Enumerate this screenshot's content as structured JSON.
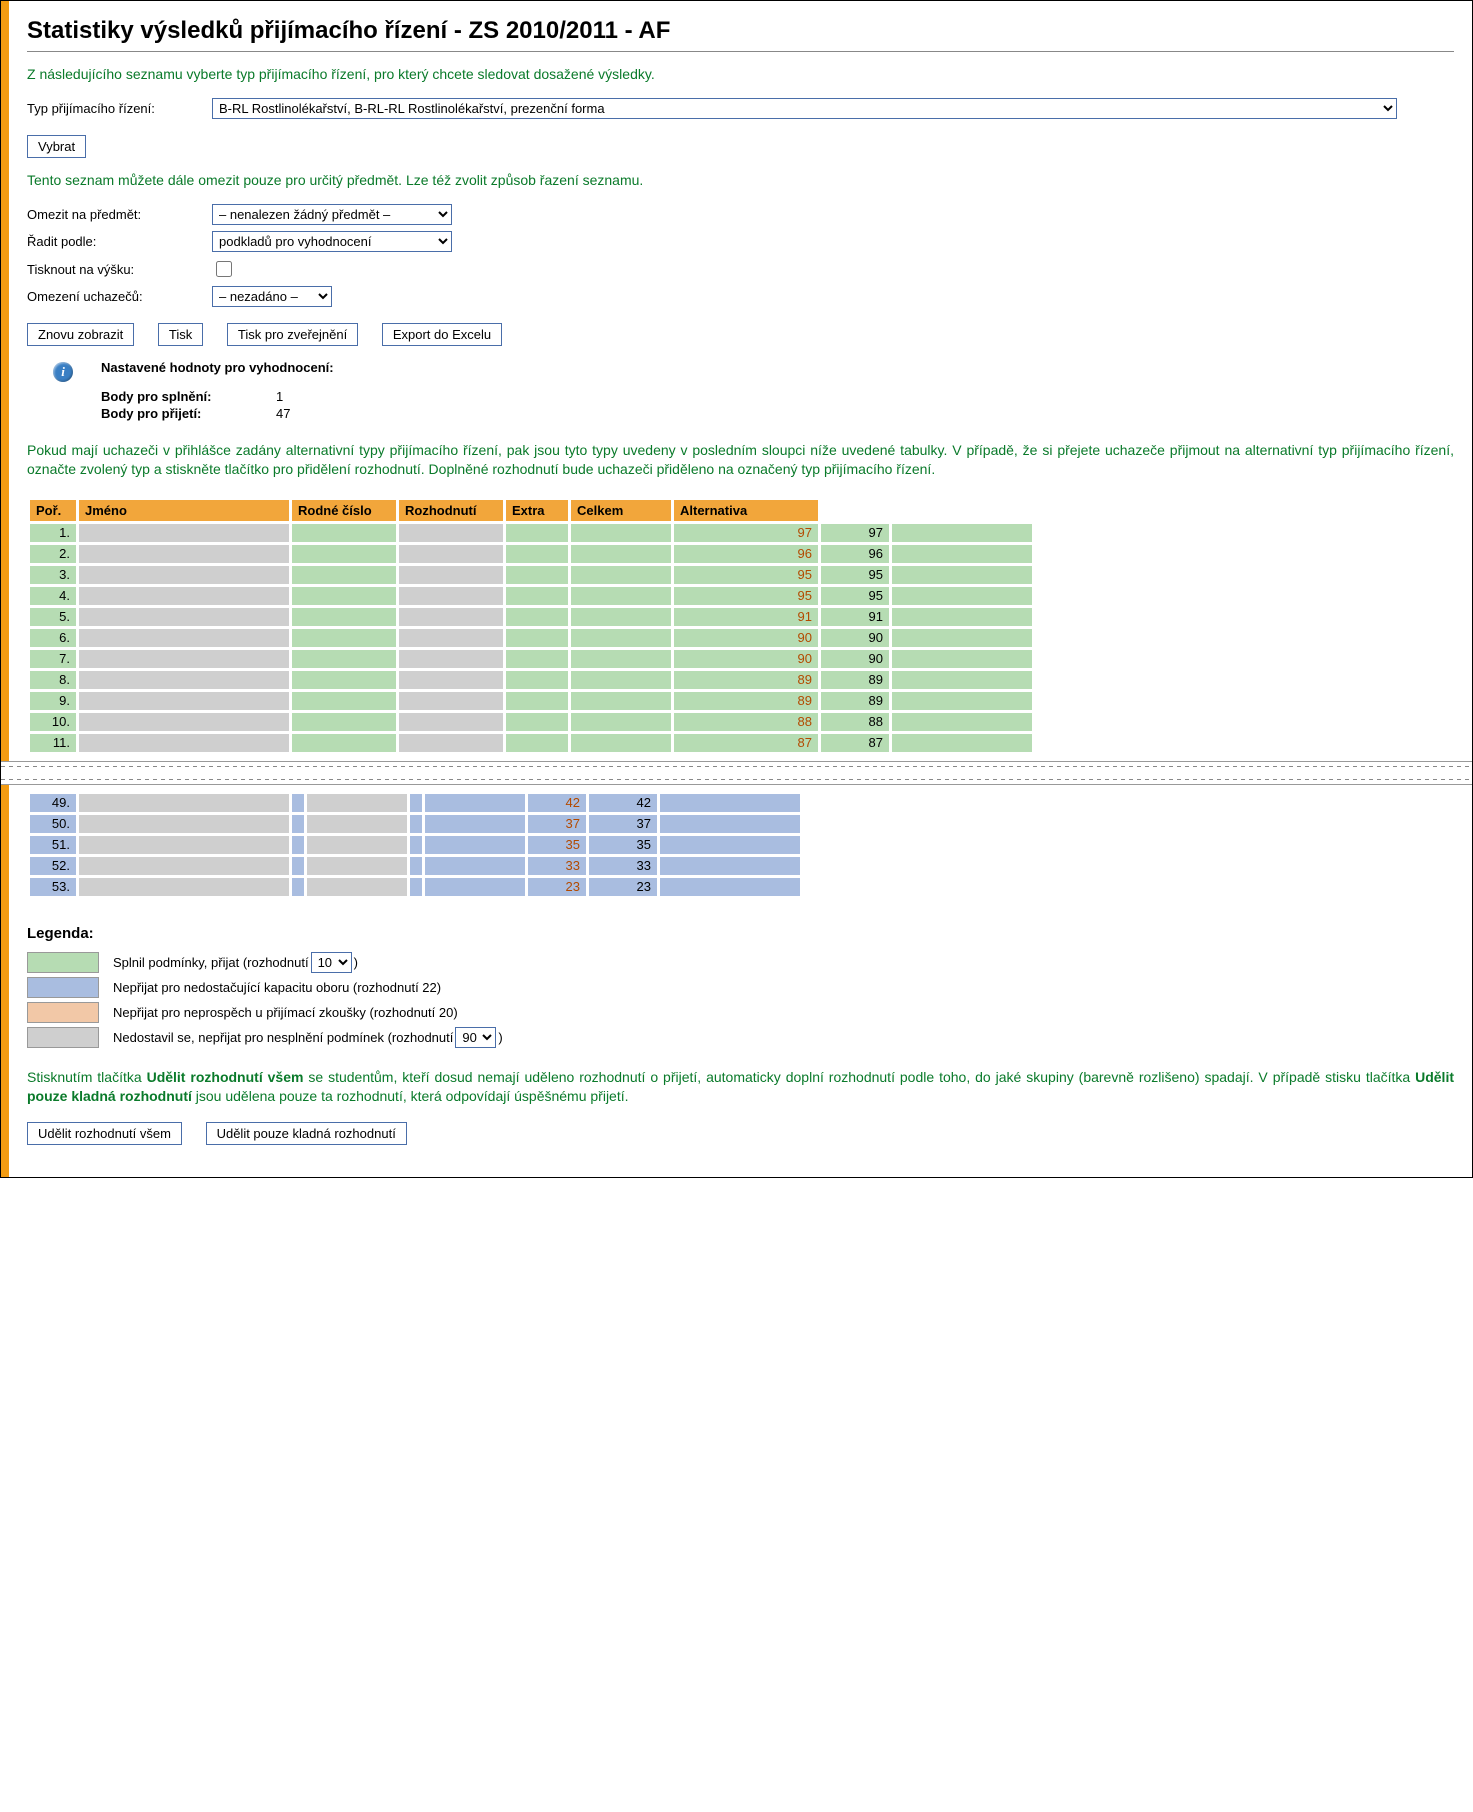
{
  "title": "Statistiky výsledků přijímacího řízení - ZS 2010/2011 - AF",
  "intro": "Z následujícího seznamu vyberte typ přijímacího řízení, pro který chcete sledovat dosažené výsledky.",
  "form": {
    "type_label": "Typ přijímacího řízení:",
    "type_value": "B-RL Rostlinolékařství, B-RL-RL Rostlinolékařství, prezenční forma",
    "select_btn": "Vybrat",
    "filter_intro": "Tento seznam můžete dále omezit pouze pro určitý předmět. Lze též zvolit způsob řazení seznamu.",
    "subject_label": "Omezit na předmět:",
    "subject_value": "– nenalezen žádný předmět –",
    "sort_label": "Řadit podle:",
    "sort_value": "podkladů pro vyhodnocení",
    "print_height_label": "Tisknout na výšku:",
    "limit_label": "Omezení uchazečů:",
    "limit_value": "– nezadáno –",
    "buttons": {
      "refresh": "Znovu zobrazit",
      "print": "Tisk",
      "print_publish": "Tisk pro zveřejnění",
      "export": "Export do Excelu"
    }
  },
  "settings": {
    "heading": "Nastavené hodnoty pro vyhodnocení:",
    "pass_label": "Body pro splnění:",
    "pass_value": "1",
    "admit_label": "Body pro přijetí:",
    "admit_value": "47"
  },
  "paragraph": "Pokud mají uchazeči v přihlášce zadány alternativní typy přijímacího řízení, pak jsou tyto typy uvedeny v posledním sloupci níže uvedené tabulky. V případě, že si přejete uchazeče přijmout na alternativní typ přijímacího řízení, označte zvolený typ a stiskněte tlačítko pro přidělení rozhodnutí. Doplněné rozhodnutí bude uchazeči přiděleno na označený typ přijímacího řízení.",
  "table": {
    "headers": {
      "por": "Poř.",
      "jmeno": "Jméno",
      "rc": "Rodné číslo",
      "roz": "Rozhodnutí",
      "extra": "Extra",
      "celkem": "Celkem",
      "alt": "Alternativa"
    },
    "rows_top": [
      {
        "por": "1.",
        "extra": "97",
        "celkem": "97"
      },
      {
        "por": "2.",
        "extra": "96",
        "celkem": "96"
      },
      {
        "por": "3.",
        "extra": "95",
        "celkem": "95"
      },
      {
        "por": "4.",
        "extra": "95",
        "celkem": "95"
      },
      {
        "por": "5.",
        "extra": "91",
        "celkem": "91"
      },
      {
        "por": "6.",
        "extra": "90",
        "celkem": "90"
      },
      {
        "por": "7.",
        "extra": "90",
        "celkem": "90"
      },
      {
        "por": "8.",
        "extra": "89",
        "celkem": "89"
      },
      {
        "por": "9.",
        "extra": "89",
        "celkem": "89"
      },
      {
        "por": "10.",
        "extra": "88",
        "celkem": "88"
      },
      {
        "por": "11.",
        "extra": "87",
        "celkem": "87"
      }
    ],
    "rows_bottom": [
      {
        "por": "49.",
        "extra": "42",
        "celkem": "42"
      },
      {
        "por": "50.",
        "extra": "37",
        "celkem": "37"
      },
      {
        "por": "51.",
        "extra": "35",
        "celkem": "35"
      },
      {
        "por": "52.",
        "extra": "33",
        "celkem": "33"
      },
      {
        "por": "53.",
        "extra": "23",
        "celkem": "23"
      }
    ]
  },
  "legend": {
    "heading": "Legenda:",
    "green_pre": "Splnil podmínky, přijat (rozhodnutí ",
    "green_sel": "10",
    "green_post": ")",
    "blue": "Nepřijat pro nedostačující kapacitu oboru (rozhodnutí 22)",
    "orange": "Nepřijat pro neprospěch u přijímací zkoušky (rozhodnutí 20)",
    "grey_pre": "Nedostavil se, nepřijat pro nesplnění podmínek (rozhodnutí ",
    "grey_sel": "90",
    "grey_post": ")"
  },
  "final": {
    "pre": "Stisknutím tlačítka ",
    "b1": "Udělit rozhodnutí všem",
    "mid": " se studentům, kteří dosud nemají uděleno rozhodnutí o přijetí, automaticky doplní rozhodnutí podle toho, do jaké skupiny (barevně rozlišeno) spadají. V případě stisku tlačítka ",
    "b2": "Udělit pouze kladná rozhodnutí",
    "post": " jsou udělena pouze ta rozhodnutí, která odpovídají úspěšnému přijetí.",
    "btn_all": "Udělit rozhodnutí všem",
    "btn_pos": "Udělit pouze kladná rozhodnutí"
  }
}
